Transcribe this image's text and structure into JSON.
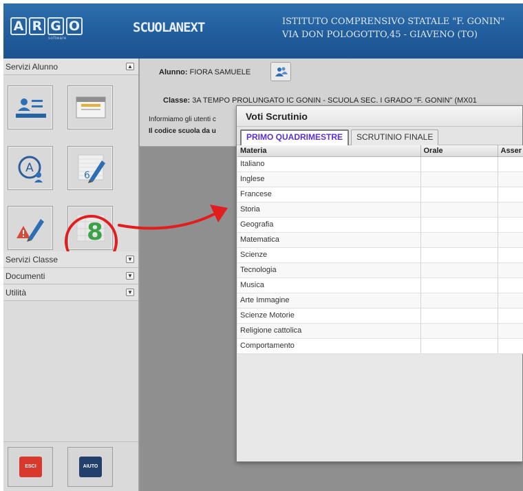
{
  "header": {
    "logo_letters": [
      "A",
      "R",
      "G",
      "O"
    ],
    "logo_sub": "software",
    "brand": "SCUOLANEXT",
    "school_line1": "ISTITUTO COMPRENSIVO STATALE \"F. GONIN\"",
    "school_line2": "VIA DON POLOGOTTO,45 - GIAVENO (TO)",
    "header_color": "#215d9c"
  },
  "sidebar": {
    "sections": [
      {
        "label": "Servizi Alunno",
        "toggle": "▲"
      },
      {
        "label": "Servizi Classe",
        "toggle": "▼"
      },
      {
        "label": "Documenti",
        "toggle": "▼"
      },
      {
        "label": "Utilità",
        "toggle": "▼"
      }
    ],
    "tiles": [
      {
        "icon": "student-card-icon"
      },
      {
        "icon": "register-icon"
      },
      {
        "icon": "absences-icon"
      },
      {
        "icon": "grades-pencil-icon",
        "badge": "6"
      },
      {
        "icon": "notes-warning-icon"
      },
      {
        "icon": "scrutinio-grades-icon",
        "badge": "8"
      }
    ],
    "exit_label": "ESCI",
    "help_label": "AIUTO",
    "highlight_color": "#e11d1d"
  },
  "info": {
    "student_label": "Alunno:",
    "student_name": "FIORA SAMUELE",
    "class_label": "Classe:",
    "class_value": "3A TEMPO PROLUNGATO IC GONIN - SCUOLA SEC. I GRADO \"F. GONIN\" (MX01",
    "notice_line1": "Informiamo gli utenti c",
    "notice_line2": "Il codice scuola da u"
  },
  "dialog": {
    "title": "Voti Scrutinio",
    "tabs": [
      {
        "label": "PRIMO QUADRIMESTRE",
        "active": true
      },
      {
        "label": "SCRUTINIO FINALE",
        "active": false
      }
    ],
    "columns": [
      "Materia",
      "Orale",
      "Asser"
    ],
    "subjects": [
      "Italiano",
      "Inglese",
      "Francese",
      "Storia",
      "Geografia",
      "Matematica",
      "Scienze",
      "Tecnologia",
      "Musica",
      "Arte Immagine",
      "Scienze Motorie",
      "Religione cattolica",
      "Comportamento"
    ]
  }
}
